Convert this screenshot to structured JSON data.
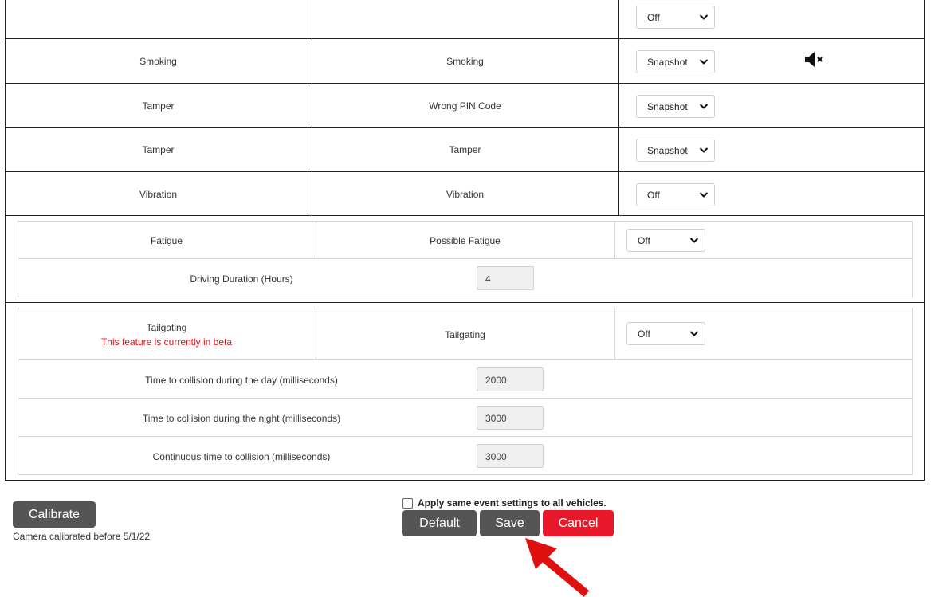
{
  "rows": [
    {
      "event": "",
      "name": "",
      "action": "Off",
      "muted": false
    },
    {
      "event": "Smoking",
      "name": "Smoking",
      "action": "Snapshot",
      "muted": true
    },
    {
      "event": "Tamper",
      "name": "Wrong PIN Code",
      "action": "Snapshot",
      "muted": false
    },
    {
      "event": "Tamper",
      "name": "Tamper",
      "action": "Snapshot",
      "muted": false
    },
    {
      "event": "Vibration",
      "name": "Vibration",
      "action": "Off",
      "muted": false
    }
  ],
  "fatigue": {
    "event": "Fatigue",
    "name": "Possible Fatigue",
    "action": "Off",
    "duration_label": "Driving Duration (Hours)",
    "duration_value": "4"
  },
  "tailgating": {
    "event": "Tailgating",
    "beta_note": "This feature is currently in beta",
    "name": "Tailgating",
    "action": "Off",
    "settings": [
      {
        "label": "Time to collision during the day (milliseconds)",
        "value": "2000"
      },
      {
        "label": "Time to collision during the night (milliseconds)",
        "value": "3000"
      },
      {
        "label": "Continuous time to collision (milliseconds)",
        "value": "3000"
      }
    ]
  },
  "footer": {
    "calibrate_label": "Calibrate",
    "calibrated_text": "Camera calibrated before 5/1/22",
    "apply_all_label": "Apply same event settings to all vehicles.",
    "apply_all_checked": false,
    "default_label": "Default",
    "save_label": "Save",
    "cancel_label": "Cancel"
  },
  "icons": {
    "mute": "speaker-muted-icon",
    "chevron": "chevron-down-icon",
    "arrow": "red-arrow-annotation"
  },
  "colors": {
    "button_dark": "#555555",
    "button_cancel": "#e8172a",
    "beta_text": "#e01010",
    "annotation_arrow": "#e01010"
  }
}
